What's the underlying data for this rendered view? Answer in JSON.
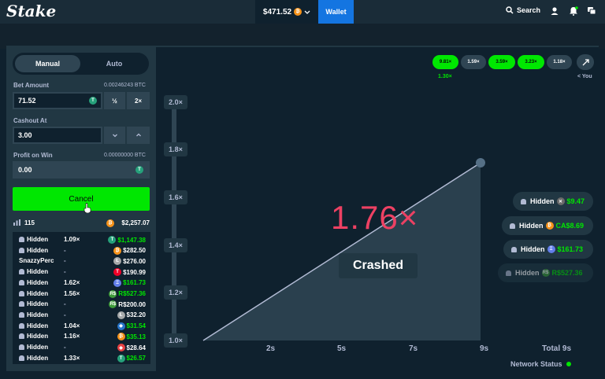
{
  "header": {
    "logo": "Stake",
    "balance": "$471.52",
    "wallet_label": "Wallet",
    "search_label": "Search"
  },
  "sidebar": {
    "mode_manual": "Manual",
    "mode_auto": "Auto",
    "bet_amount_label": "Bet Amount",
    "bet_amount_btc": "0.00246243 BTC",
    "bet_amount_value": "71.52",
    "half_label": "½",
    "double_label": "2×",
    "cashout_label": "Cashout At",
    "cashout_value": "3.00",
    "profit_label": "Profit on Win",
    "profit_btc": "0.00000000 BTC",
    "profit_value": "0.00",
    "cancel_label": "Cancel",
    "player_count": "115",
    "total_bet": "$2,257.07"
  },
  "players": [
    {
      "name": "Hidden",
      "hidden": true,
      "mult": "1.09×",
      "amount": "$1,147.38",
      "won": true,
      "coin": "T",
      "coin_color": "#26a17b"
    },
    {
      "name": "Hidden",
      "hidden": true,
      "mult": "-",
      "amount": "$282.50",
      "won": false,
      "coin": "₿",
      "coin_color": "#f7931a"
    },
    {
      "name": "SnazzyPerc",
      "hidden": false,
      "mult": "-",
      "amount": "$276.00",
      "won": false,
      "coin": "Ł",
      "coin_color": "#a6a9aa"
    },
    {
      "name": "Hidden",
      "hidden": true,
      "mult": "-",
      "amount": "$190.99",
      "won": false,
      "coin": "T",
      "coin_color": "#ef0027"
    },
    {
      "name": "Hidden",
      "hidden": true,
      "mult": "1.62×",
      "amount": "$161.73",
      "won": true,
      "coin": "Ξ",
      "coin_color": "#627eea"
    },
    {
      "name": "Hidden",
      "hidden": true,
      "mult": "1.56×",
      "amount": "R$527.36",
      "won": true,
      "coin": "R$",
      "coin_color": "#3e9b3a"
    },
    {
      "name": "Hidden",
      "hidden": true,
      "mult": "-",
      "amount": "R$200.00",
      "won": false,
      "coin": "R$",
      "coin_color": "#3e9b3a"
    },
    {
      "name": "Hidden",
      "hidden": true,
      "mult": "-",
      "amount": "$32.20",
      "won": false,
      "coin": "Ł",
      "coin_color": "#a6a9aa"
    },
    {
      "name": "Hidden",
      "hidden": true,
      "mult": "1.04×",
      "amount": "$31.54",
      "won": true,
      "coin": "◆",
      "coin_color": "#2775ca"
    },
    {
      "name": "Hidden",
      "hidden": true,
      "mult": "1.16×",
      "amount": "$35.13",
      "won": true,
      "coin": "₿",
      "coin_color": "#f7931a"
    },
    {
      "name": "Hidden",
      "hidden": true,
      "mult": "-",
      "amount": "$28.64",
      "won": false,
      "coin": "◆",
      "coin_color": "#e84142"
    },
    {
      "name": "Hidden",
      "hidden": true,
      "mult": "1.33×",
      "amount": "$26.57",
      "won": true,
      "coin": "T",
      "coin_color": "#26a17b"
    }
  ],
  "history": {
    "chips": [
      {
        "value": "9.81×",
        "high": true
      },
      {
        "value": "1.59×",
        "high": false
      },
      {
        "value": "3.59×",
        "high": true
      },
      {
        "value": "3.23×",
        "high": true
      },
      {
        "value": "1.18×",
        "high": false
      }
    ],
    "note_value": "1.30×",
    "note_you": "< You"
  },
  "game": {
    "current_multiplier": "1.76×",
    "crashed_label": "Crashed",
    "y_labels": [
      "2.0×",
      "1.8×",
      "1.6×",
      "1.4×",
      "1.2×",
      "1.0×"
    ],
    "x_labels": [
      "2s",
      "5s",
      "7s",
      "9s"
    ],
    "total_label": "Total 9s",
    "network_status": "Network Status"
  },
  "cashouts": [
    {
      "name": "Hidden",
      "amount": "$9.47",
      "coin": "✕",
      "coin_color": "#6b6b6b"
    },
    {
      "name": "Hidden",
      "amount": "CA$8.69",
      "coin": "₿",
      "coin_color": "#f7931a"
    },
    {
      "name": "Hidden",
      "amount": "$161.73",
      "coin": "Ξ",
      "coin_color": "#627eea"
    },
    {
      "name": "Hidden",
      "amount": "R$527.36",
      "coin": "R$",
      "coin_color": "#3e9b3a"
    }
  ],
  "colors": {
    "accent_green": "#00e701",
    "wallet_blue": "#1475e1",
    "crash_red": "#ed4163"
  }
}
